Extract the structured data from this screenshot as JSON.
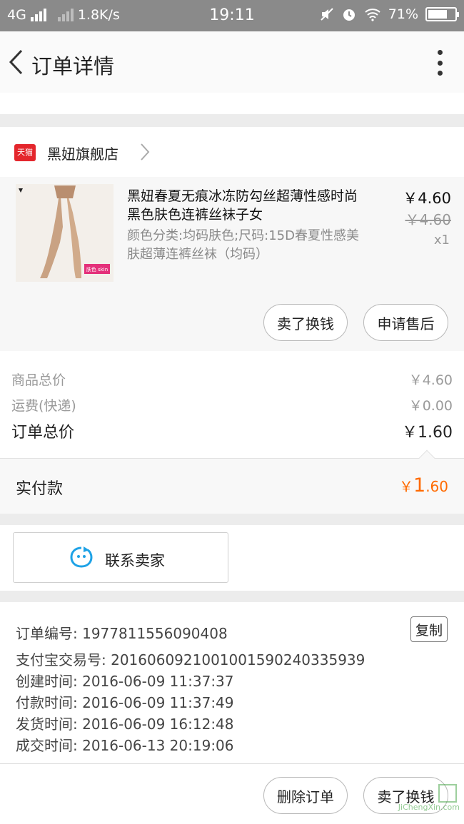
{
  "status_bar": {
    "network": "4G",
    "speed": "1.8K/s",
    "time": "19:11",
    "battery": "71%",
    "battery_level": 0.71
  },
  "header": {
    "title": "订单详情"
  },
  "store": {
    "badge": "天猫",
    "name": "黑妞旗舰店"
  },
  "product": {
    "title": "黑妞春夏无痕冰冻防勾丝超薄性感时尚黑色肤色连裤丝袜子女",
    "sku": "颜色分类:均码肤色;尺码:15D春夏性感美肤超薄连裤丝袜（均码）",
    "price": "￥4.60",
    "original_price": "￥4.60",
    "quantity": "x1",
    "image_tag": "肤色 skin",
    "buttons": [
      "卖了换钱",
      "申请售后"
    ]
  },
  "totals": {
    "goods_label": "商品总价",
    "goods_value": "￥4.60",
    "shipping_label": "运费(快递)",
    "shipping_value": "￥0.00",
    "order_label": "订单总价",
    "order_value": "￥1.60"
  },
  "paid": {
    "label": "实付款",
    "currency": "￥",
    "integer": "1",
    "decimal": ".60",
    "accent": "#ff6a00"
  },
  "contact": {
    "label": "联系卖家",
    "icon": "chat-bubble-icon"
  },
  "order_info": {
    "copy_label": "复制",
    "lines": [
      "订单编号: 1977811556090408",
      "支付宝交易号: 2016060921001001590240335939",
      "创建时间: 2016-06-09 11:37:37",
      "付款时间: 2016-06-09 11:37:49",
      "发货时间: 2016-06-09 16:12:48",
      "成交时间: 2016-06-13 20:19:06"
    ]
  },
  "footer": {
    "delete_label": "删除订单",
    "sell_label": "卖了换钱"
  },
  "watermark": {
    "site": "JiChengXin.com"
  }
}
